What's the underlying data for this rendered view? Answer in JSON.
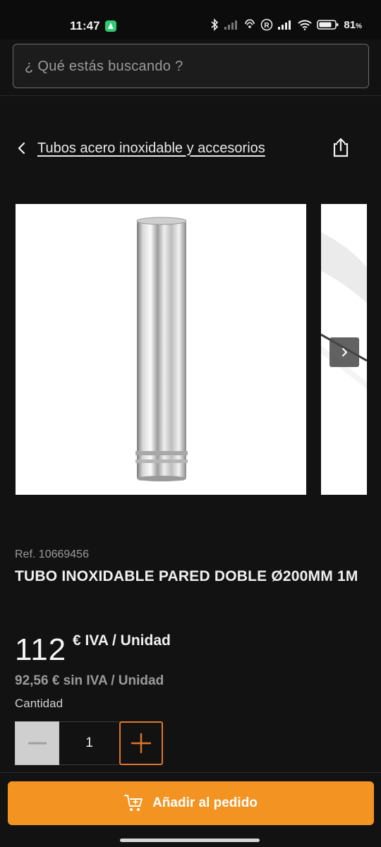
{
  "status_bar": {
    "time": "11:47",
    "battery": "81",
    "battery_unit": "%"
  },
  "search": {
    "placeholder": "¿ Qué estás buscando ?"
  },
  "breadcrumb": {
    "label": "Tubos acero inoxidable y accesorios"
  },
  "product": {
    "ref": "Ref. 10669456",
    "title": "TUBO INOXIDABLE PARED DOBLE Ø200MM 1M",
    "price_main": "112",
    "price_unit": "€ IVA / Unidad",
    "price_net": "92,56 € sin IVA / Unidad"
  },
  "quantity": {
    "label": "Cantidad",
    "value": "1"
  },
  "cart": {
    "add_label": "Añadir al pedido"
  },
  "colors": {
    "accent": "#f39321",
    "plus_border": "#e0762b",
    "background": "#121212"
  },
  "icons": [
    "app-store-icon",
    "bluetooth-icon",
    "signal-icon",
    "wifi-icon",
    "battery-icon",
    "back-icon",
    "share-icon",
    "chevron-right-icon",
    "minus-icon",
    "plus-icon",
    "cart-icon"
  ]
}
